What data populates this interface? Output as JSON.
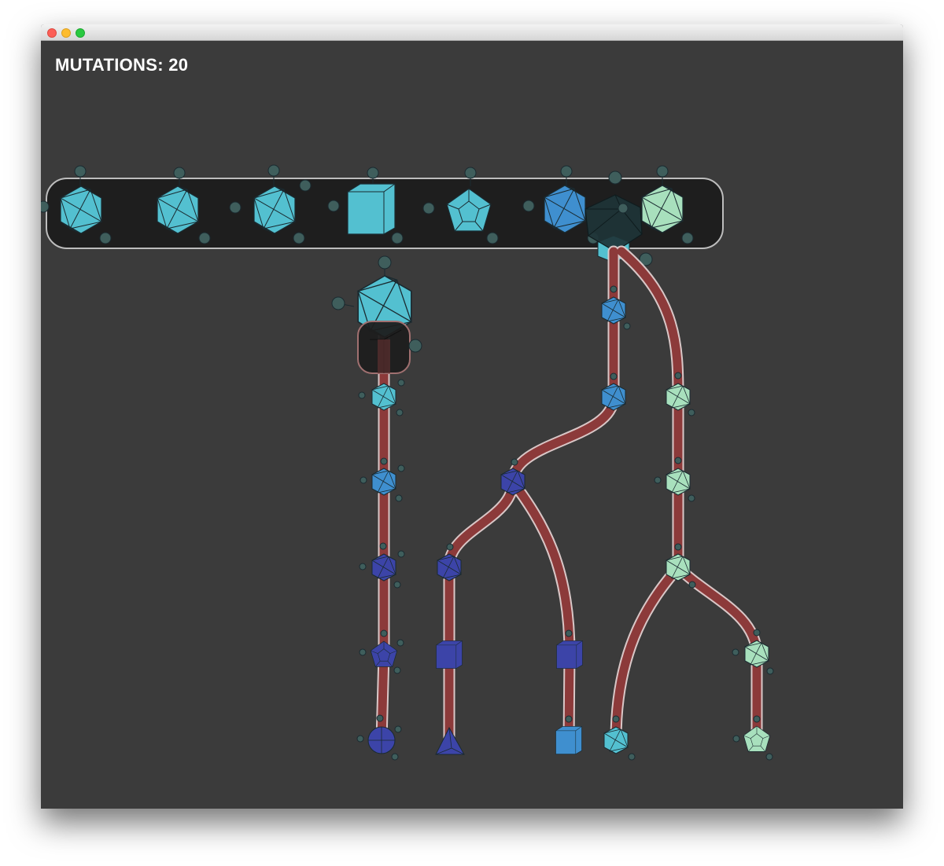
{
  "window": {
    "controls": [
      "close",
      "minimize",
      "maximize"
    ]
  },
  "hud": {
    "label": "MUTATIONS:",
    "count": "20"
  },
  "colors": {
    "background": "#3b3b3b",
    "inventory_bar": "#1e1e1e",
    "branch_outer": "#d9c7c7",
    "branch_inner": "#8c3a3a",
    "cyan": "#53c0d0",
    "blue": "#3f8fcf",
    "indigo": "#3c44a8",
    "mint": "#a8e0bd",
    "port": "#3f5e5c"
  },
  "inventory": [
    {
      "shape": "icosahedron-icon",
      "color": "cyan"
    },
    {
      "shape": "icosahedron-icon",
      "color": "cyan"
    },
    {
      "shape": "icosahedron-icon",
      "color": "cyan"
    },
    {
      "shape": "cube-icon",
      "color": "cyan"
    },
    {
      "shape": "dodecahedron-icon",
      "color": "cyan"
    },
    {
      "shape": "icosahedron-icon",
      "color": "blue"
    },
    {
      "shape": "icosahedron-icon",
      "color": "mint"
    }
  ]
}
